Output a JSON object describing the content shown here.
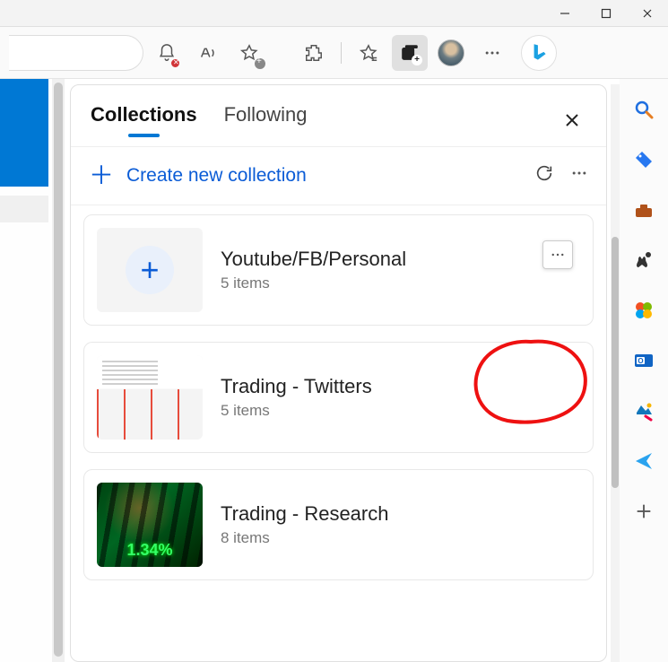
{
  "window": {
    "minimize": "—",
    "maximize": "▢",
    "close": "✕"
  },
  "tabs": {
    "collections": "Collections",
    "following": "Following"
  },
  "create": {
    "label": "Create new collection"
  },
  "collections": [
    {
      "title": "Youtube/FB/Personal",
      "subtitle": "5 items",
      "thumbType": "plus",
      "showMore": true
    },
    {
      "title": "Trading - Twitters",
      "subtitle": "5 items",
      "thumbType": "chart",
      "showMore": false
    },
    {
      "title": "Trading - Research",
      "subtitle": "8 items",
      "thumbType": "stock",
      "showMore": false
    }
  ],
  "stockOverlay": "1.34%"
}
